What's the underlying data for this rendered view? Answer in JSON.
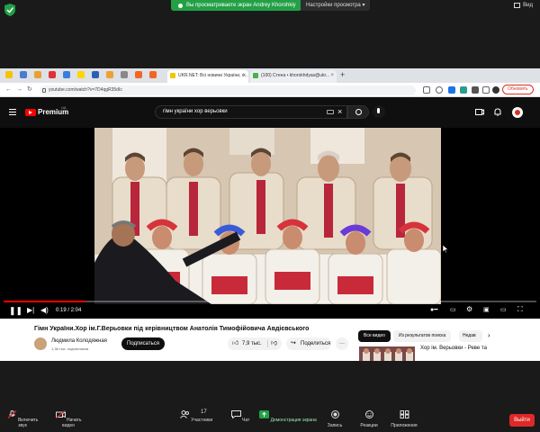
{
  "zoom": {
    "share_banner": "Вы просматриваете экран Andrey Khorohkiy",
    "view_settings": "Настройки просмотра",
    "view_label": "Вид"
  },
  "browser": {
    "tabs": [
      {
        "label": "UKR.NET: Всі новини України, о...",
        "active": false
      },
      {
        "label": "(100) Стена • khorokhdyas@ukr...",
        "active": false
      }
    ],
    "url": "youtube.com/watch?v=7D4qgR35dIc",
    "update_label": "Обновить"
  },
  "youtube": {
    "wordmark": "Premium",
    "country": "UA",
    "search_query": "гімн україни хор верьовки",
    "time": "0:19 / 2:04",
    "progress": 0.153,
    "title": "Гімн України.Хор ім.Г.Верьовки під керівництвом Анатолія Тимофійовича Авдієвського",
    "channel": "Людмила Колодяжная",
    "subscribers": "1,38 тыс. подписчиков",
    "subscribe": "Подписаться",
    "likes": "7,9 тыс.",
    "share": "Поделиться",
    "more": "···",
    "chips": [
      "Все видео",
      "Из результатов поиска",
      "Недав"
    ],
    "related_title": "Хор ім. Верьовки - Реве та"
  },
  "zoom_bar": {
    "audio": "Включить звук",
    "video": "Начать видео",
    "participants_count": "17",
    "participants": "Участники",
    "chat": "Чат",
    "share": "Демонстрация экрана",
    "record": "Запись",
    "reactions": "Реакции",
    "apps": "Приложения",
    "leave": "Выйти"
  },
  "colors": {
    "zoom_green": "#23a046",
    "yt_red": "#ff0000",
    "leave_red": "#e02828"
  }
}
